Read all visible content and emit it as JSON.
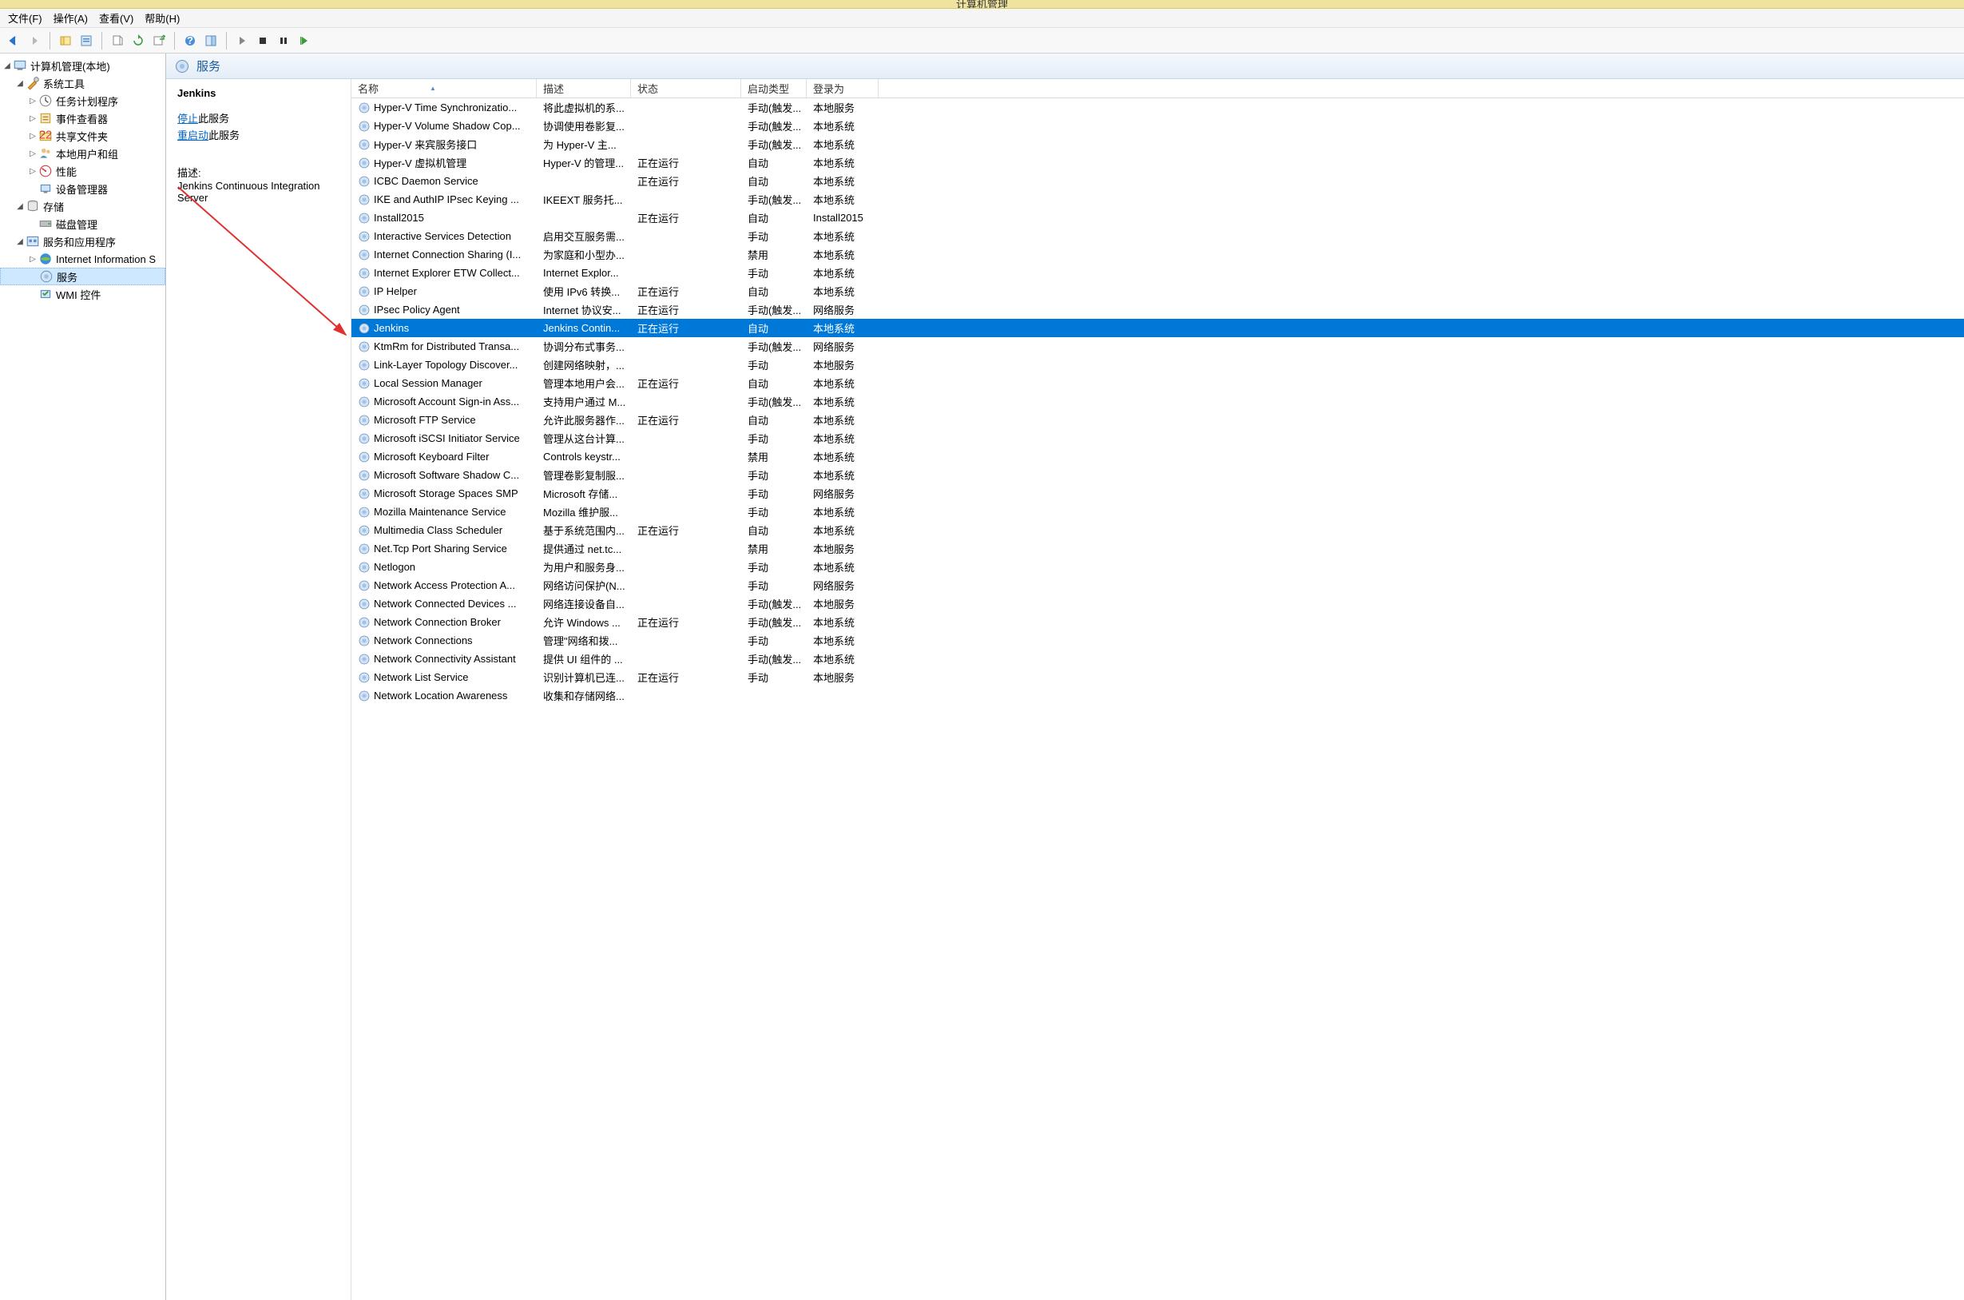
{
  "titlebar": "计算机管理",
  "menubar": {
    "file": "文件(F)",
    "action": "操作(A)",
    "view": "查看(V)",
    "help": "帮助(H)"
  },
  "tree": {
    "root": "计算机管理(本地)",
    "system_tools": "系统工具",
    "task_scheduler": "任务计划程序",
    "event_viewer": "事件查看器",
    "shared_folders": "共享文件夹",
    "local_users": "本地用户和组",
    "performance": "性能",
    "device_manager": "设备管理器",
    "storage": "存储",
    "disk_mgmt": "磁盘管理",
    "services_apps": "服务和应用程序",
    "iis": "Internet Information S",
    "services": "服务",
    "wmi": "WMI 控件"
  },
  "services_header": "服务",
  "detail": {
    "name": "Jenkins",
    "stop_link": "停止",
    "stop_suffix": "此服务",
    "restart_link": "重启动",
    "restart_suffix": "此服务",
    "desc_label": "描述:",
    "desc_text": "Jenkins Continuous Integration Server"
  },
  "columns": {
    "name": "名称",
    "description": "描述",
    "status": "状态",
    "startup": "启动类型",
    "logon": "登录为"
  },
  "services": [
    {
      "name": "Hyper-V Time Synchronizatio...",
      "desc": "将此虚拟机的系...",
      "status": "",
      "startup": "手动(触发...",
      "logon": "本地服务"
    },
    {
      "name": "Hyper-V Volume Shadow Cop...",
      "desc": "协调使用卷影复...",
      "status": "",
      "startup": "手动(触发...",
      "logon": "本地系统"
    },
    {
      "name": "Hyper-V 来宾服务接口",
      "desc": "为 Hyper-V 主...",
      "status": "",
      "startup": "手动(触发...",
      "logon": "本地系统"
    },
    {
      "name": "Hyper-V 虚拟机管理",
      "desc": "Hyper-V 的管理...",
      "status": "正在运行",
      "startup": "自动",
      "logon": "本地系统"
    },
    {
      "name": "ICBC Daemon Service",
      "desc": "",
      "status": "正在运行",
      "startup": "自动",
      "logon": "本地系统"
    },
    {
      "name": "IKE and AuthIP IPsec Keying ...",
      "desc": "IKEEXT 服务托...",
      "status": "",
      "startup": "手动(触发...",
      "logon": "本地系统"
    },
    {
      "name": "Install2015",
      "desc": "",
      "status": "正在运行",
      "startup": "自动",
      "logon": "Install2015"
    },
    {
      "name": "Interactive Services Detection",
      "desc": "启用交互服务需...",
      "status": "",
      "startup": "手动",
      "logon": "本地系统"
    },
    {
      "name": "Internet Connection Sharing (I...",
      "desc": "为家庭和小型办...",
      "status": "",
      "startup": "禁用",
      "logon": "本地系统"
    },
    {
      "name": "Internet Explorer ETW Collect...",
      "desc": "Internet Explor...",
      "status": "",
      "startup": "手动",
      "logon": "本地系统"
    },
    {
      "name": "IP Helper",
      "desc": "使用 IPv6 转换...",
      "status": "正在运行",
      "startup": "自动",
      "logon": "本地系统"
    },
    {
      "name": "IPsec Policy Agent",
      "desc": "Internet 协议安...",
      "status": "正在运行",
      "startup": "手动(触发...",
      "logon": "网络服务"
    },
    {
      "name": "Jenkins",
      "desc": "Jenkins Contin...",
      "status": "正在运行",
      "startup": "自动",
      "logon": "本地系统",
      "selected": true
    },
    {
      "name": "KtmRm for Distributed Transa...",
      "desc": "协调分布式事务...",
      "status": "",
      "startup": "手动(触发...",
      "logon": "网络服务"
    },
    {
      "name": "Link-Layer Topology Discover...",
      "desc": "创建网络映射，...",
      "status": "",
      "startup": "手动",
      "logon": "本地服务"
    },
    {
      "name": "Local Session Manager",
      "desc": "管理本地用户会...",
      "status": "正在运行",
      "startup": "自动",
      "logon": "本地系统"
    },
    {
      "name": "Microsoft Account Sign-in Ass...",
      "desc": "支持用户通过 M...",
      "status": "",
      "startup": "手动(触发...",
      "logon": "本地系统"
    },
    {
      "name": "Microsoft FTP Service",
      "desc": "允许此服务器作...",
      "status": "正在运行",
      "startup": "自动",
      "logon": "本地系统"
    },
    {
      "name": "Microsoft iSCSI Initiator Service",
      "desc": "管理从这台计算...",
      "status": "",
      "startup": "手动",
      "logon": "本地系统"
    },
    {
      "name": "Microsoft Keyboard Filter",
      "desc": "Controls keystr...",
      "status": "",
      "startup": "禁用",
      "logon": "本地系统"
    },
    {
      "name": "Microsoft Software Shadow C...",
      "desc": "管理卷影复制服...",
      "status": "",
      "startup": "手动",
      "logon": "本地系统"
    },
    {
      "name": "Microsoft Storage Spaces SMP",
      "desc": "Microsoft 存储...",
      "status": "",
      "startup": "手动",
      "logon": "网络服务"
    },
    {
      "name": "Mozilla Maintenance Service",
      "desc": "Mozilla 维护服...",
      "status": "",
      "startup": "手动",
      "logon": "本地系统"
    },
    {
      "name": "Multimedia Class Scheduler",
      "desc": "基于系统范围内...",
      "status": "正在运行",
      "startup": "自动",
      "logon": "本地系统"
    },
    {
      "name": "Net.Tcp Port Sharing Service",
      "desc": "提供通过 net.tc...",
      "status": "",
      "startup": "禁用",
      "logon": "本地服务"
    },
    {
      "name": "Netlogon",
      "desc": "为用户和服务身...",
      "status": "",
      "startup": "手动",
      "logon": "本地系统"
    },
    {
      "name": "Network Access Protection A...",
      "desc": "网络访问保护(N...",
      "status": "",
      "startup": "手动",
      "logon": "网络服务"
    },
    {
      "name": "Network Connected Devices ...",
      "desc": "网络连接设备自...",
      "status": "",
      "startup": "手动(触发...",
      "logon": "本地服务"
    },
    {
      "name": "Network Connection Broker",
      "desc": "允许 Windows ...",
      "status": "正在运行",
      "startup": "手动(触发...",
      "logon": "本地系统"
    },
    {
      "name": "Network Connections",
      "desc": "管理\"网络和拨...",
      "status": "",
      "startup": "手动",
      "logon": "本地系统"
    },
    {
      "name": "Network Connectivity Assistant",
      "desc": "提供 UI 组件的 ...",
      "status": "",
      "startup": "手动(触发...",
      "logon": "本地系统"
    },
    {
      "name": "Network List Service",
      "desc": "识别计算机已连...",
      "status": "正在运行",
      "startup": "手动",
      "logon": "本地服务"
    },
    {
      "name": "Network Location Awareness",
      "desc": "收集和存储网络...",
      "status": "",
      "startup": "",
      "logon": ""
    }
  ]
}
